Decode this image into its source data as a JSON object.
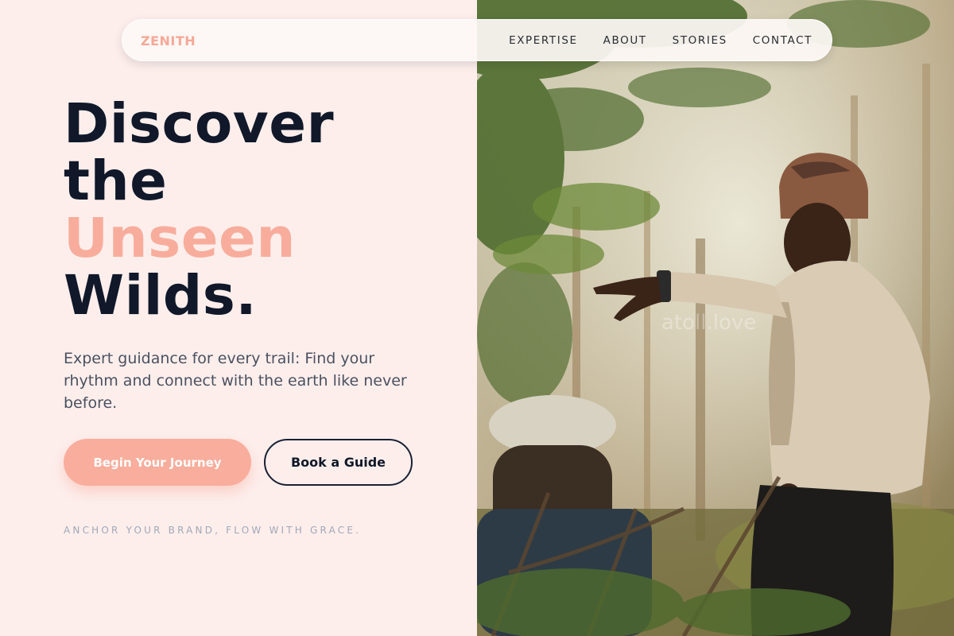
{
  "brand": {
    "logo": "ZENITH",
    "accent_color": "#f9ad9c",
    "dark_color": "#101829"
  },
  "nav": {
    "links": [
      "EXPERTISE",
      "ABOUT",
      "STORIES",
      "CONTACT"
    ]
  },
  "hero": {
    "headline": [
      "Discover",
      "the",
      "Unseen",
      "Wilds."
    ],
    "subtitle": "Expert guidance for every trail: Find your rhythm and connect with the earth like never before.",
    "primary_button": "Begin Your Journey",
    "secondary_button": "Book a Guide",
    "tagline": "ANCHOR YOUR BRAND, FLOW WITH GRACE."
  },
  "photo": {
    "watermark": "atoll.love",
    "description_icon": "photo-hiker-pointing"
  }
}
